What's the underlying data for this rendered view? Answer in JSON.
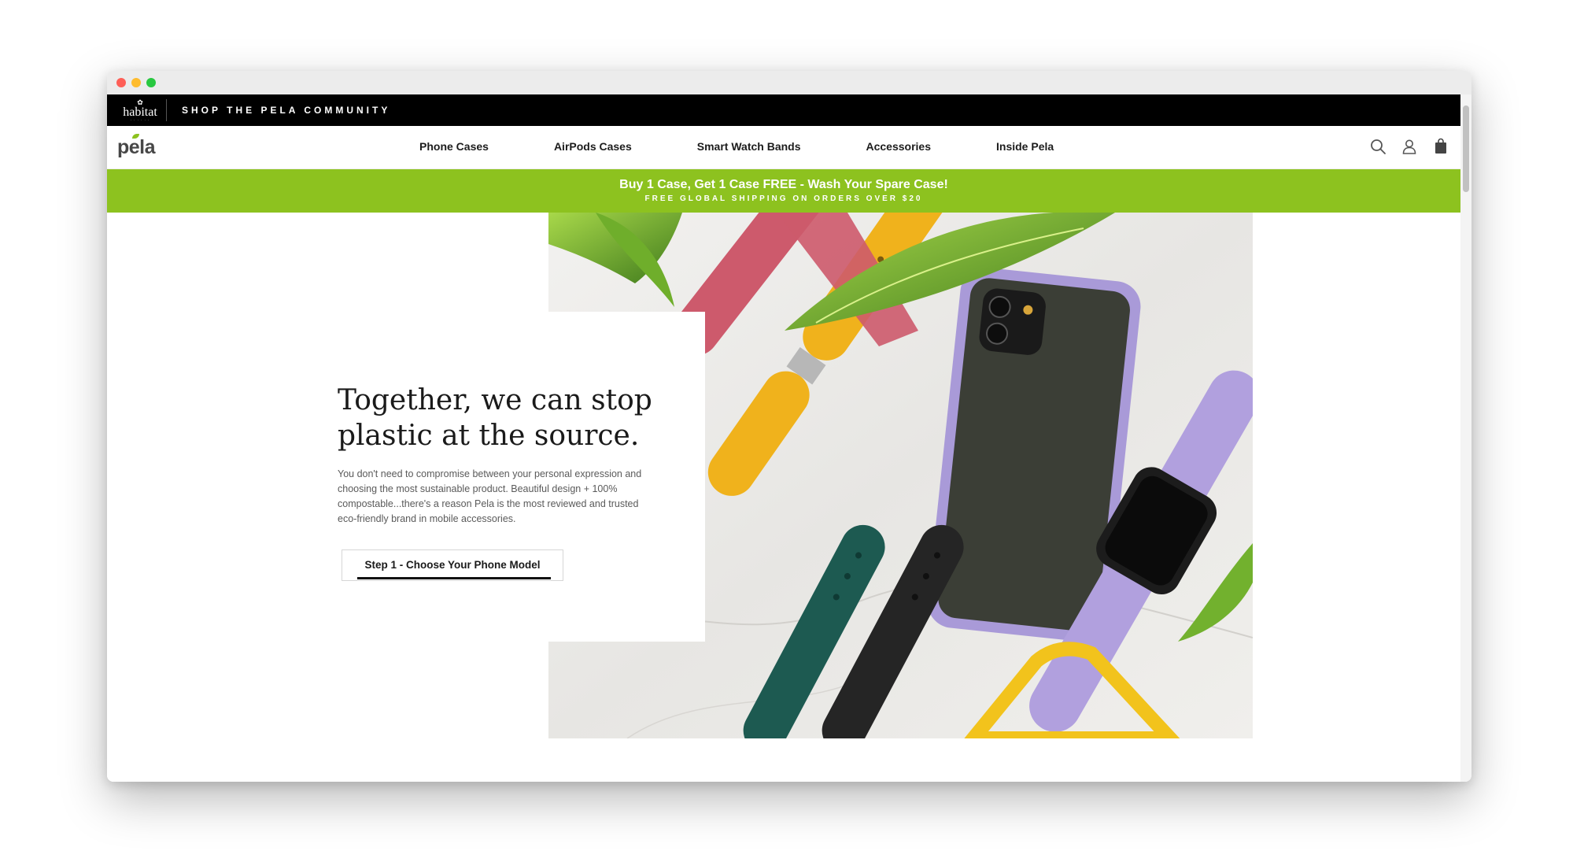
{
  "community_bar": {
    "brand": "habitat",
    "link": "SHOP THE PELA COMMUNITY"
  },
  "header": {
    "logo": "pela",
    "nav": [
      {
        "label": "Phone Cases"
      },
      {
        "label": "AirPods Cases"
      },
      {
        "label": "Smart Watch Bands"
      },
      {
        "label": "Accessories"
      },
      {
        "label": "Inside Pela"
      }
    ],
    "icons": [
      "search-icon",
      "account-icon",
      "cart-icon"
    ]
  },
  "promo": {
    "headline": "Buy 1 Case, Get 1 Case FREE - Wash Your Spare Case!",
    "subline": "FREE GLOBAL SHIPPING ON ORDERS OVER $20"
  },
  "hero": {
    "title": "Together, we can stop plastic at the source.",
    "body": "You don't need to compromise between your personal expression and choosing the most sustainable product. Beautiful design + 100% compostable...there's a reason Pela is the most reviewed and trusted eco-friendly brand in mobile accessories.",
    "cta": "Step 1 - Choose Your Phone Model"
  },
  "colors": {
    "promo_green": "#8dc21f",
    "top_bar": "#000000",
    "text_dark": "#1a1a1a"
  }
}
